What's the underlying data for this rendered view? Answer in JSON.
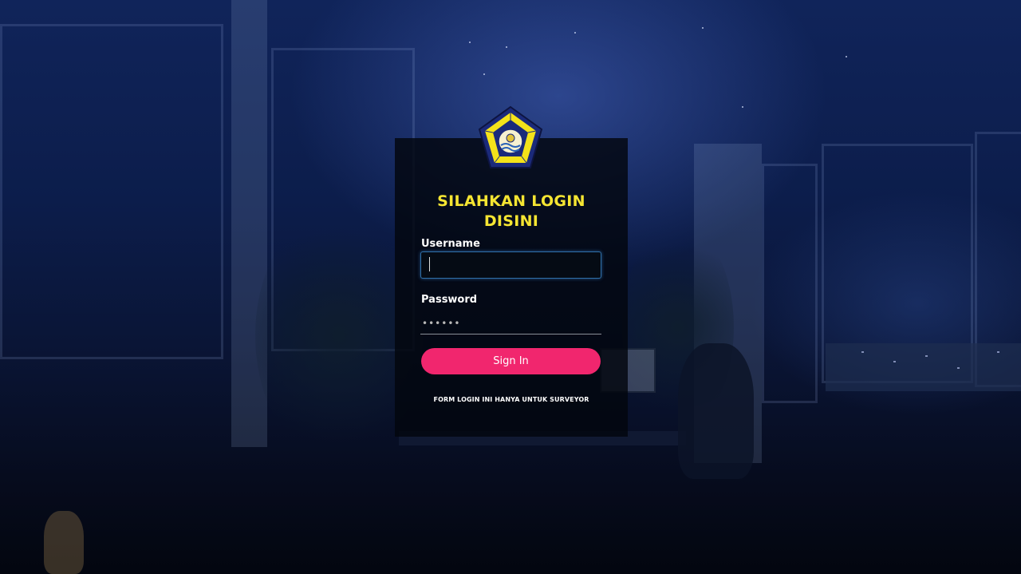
{
  "login": {
    "title_line1": "SILAHKAN LOGIN",
    "title_line2": "DISINI",
    "username_label": "Username",
    "username_value": "",
    "password_label": "Password",
    "password_value": "••••••",
    "signin_label": "Sign In",
    "footer_note": "FORM LOGIN INI HANYA UNTUK SURVEYOR"
  },
  "logo": {
    "icon": "pentagon-emblem-icon"
  },
  "colors": {
    "title": "#f5e532",
    "button": "#f1266e",
    "input_border": "#2f6fa8"
  }
}
